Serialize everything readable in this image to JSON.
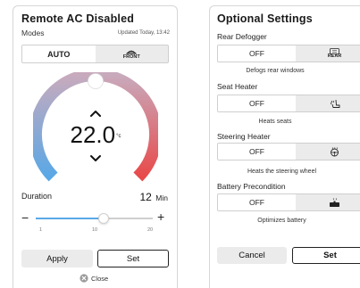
{
  "remote": {
    "title": "Remote AC Disabled",
    "modes_label": "Modes",
    "updated": "Updated Today, 13:42",
    "modes": [
      {
        "label": "AUTO",
        "active": true
      },
      {
        "label": "FRONT",
        "icon": "front-defrost-icon",
        "active": false
      }
    ],
    "temperature": "22.0",
    "temp_unit": "°c",
    "duration_label": "Duration",
    "duration_value": "12",
    "duration_unit": "Min",
    "slider": {
      "min": "1",
      "mid": "10",
      "max": "20",
      "fraction": 0.58,
      "minus": "−",
      "plus": "+"
    },
    "apply_label": "Apply",
    "set_label": "Set",
    "close_label": "Close"
  },
  "optional": {
    "title": "Optional Settings",
    "sections": [
      {
        "label": "Rear Defogger",
        "off": "OFF",
        "icon": "rear-defrost-icon",
        "icon_text": "REAR",
        "desc": "Defogs rear windows"
      },
      {
        "label": "Seat Heater",
        "off": "OFF",
        "icon": "seat-heater-icon",
        "desc": "Heats seats"
      },
      {
        "label": "Steering Heater",
        "off": "OFF",
        "icon": "steering-heater-icon",
        "desc": "Heats the steering wheel"
      },
      {
        "label": "Battery Precondition",
        "off": "OFF",
        "icon": "battery-heater-icon",
        "desc": "Optimizes battery"
      }
    ],
    "cancel_label": "Cancel",
    "set_label": "Set"
  },
  "colors": {
    "cool": "#5aa8e6",
    "warm": "#e84a4a",
    "neutral": "#c8aabd"
  }
}
